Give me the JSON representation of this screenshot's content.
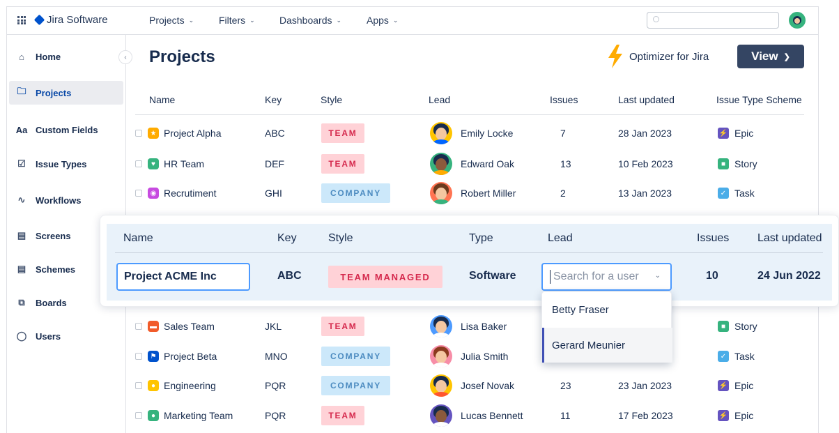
{
  "app": {
    "name": "Jira Software"
  },
  "topnav": {
    "items": [
      {
        "label": "Projects"
      },
      {
        "label": "Filters"
      },
      {
        "label": "Dashboards"
      },
      {
        "label": "Apps"
      }
    ],
    "search": {
      "placeholder": ""
    }
  },
  "sidebar": {
    "items": [
      {
        "label": "Home",
        "icon": "home-icon"
      },
      {
        "label": "Projects",
        "icon": "folder-icon",
        "active": true
      },
      {
        "label": "Custom Fields",
        "icon": "text-icon"
      },
      {
        "label": "Issue Types",
        "icon": "check-circle-icon"
      },
      {
        "label": "Workflows",
        "icon": "workflow-icon"
      },
      {
        "label": "Screens",
        "icon": "screen-icon"
      },
      {
        "label": "Schemes",
        "icon": "scheme-icon"
      },
      {
        "label": "Boards",
        "icon": "board-icon"
      },
      {
        "label": "Users",
        "icon": "user-icon"
      }
    ]
  },
  "main": {
    "title": "Projects",
    "optimizer_label": "Optimizer for Jira",
    "view_button": "View",
    "columns": [
      "Name",
      "Key",
      "Style",
      "Lead",
      "Issues",
      "Last updated",
      "Issue Type Scheme"
    ],
    "rows": [
      {
        "name": "Project Alpha",
        "key": "ABC",
        "style": "TEAM",
        "lead": "Emily Locke",
        "issues": "7",
        "updated": "28 Jan 2023",
        "scheme": "Epic"
      },
      {
        "name": "HR Team",
        "key": "DEF",
        "style": "TEAM",
        "lead": "Edward Oak",
        "issues": "13",
        "updated": "10 Feb 2023",
        "scheme": "Story"
      },
      {
        "name": "Recrutiment",
        "key": "GHI",
        "style": "COMPANY",
        "lead": "Robert Miller",
        "issues": "2",
        "updated": "13 Jan 2023",
        "scheme": "Task"
      },
      {
        "name": "Sales Team",
        "key": "JKL",
        "style": "TEAM",
        "lead": "Lisa Baker",
        "issues": "",
        "updated": "",
        "scheme": "Story"
      },
      {
        "name": "Project Beta",
        "key": "MNO",
        "style": "COMPANY",
        "lead": "Julia Smith",
        "issues": "",
        "updated": "",
        "scheme": "Task"
      },
      {
        "name": "Engineering",
        "key": "PQR",
        "style": "COMPANY",
        "lead": "Josef Novak",
        "issues": "23",
        "updated": "23 Jan 2023",
        "scheme": "Epic"
      },
      {
        "name": "Marketing Team",
        "key": "PQR",
        "style": "TEAM",
        "lead": "Lucas Bennett",
        "issues": "11",
        "updated": "17 Feb 2023",
        "scheme": "Epic"
      }
    ]
  },
  "overlay": {
    "columns": [
      "Name",
      "Key",
      "Style",
      "Type",
      "Lead",
      "Issues",
      "Last updated"
    ],
    "name": "Project ACME Inc",
    "key": "ABC",
    "style": "TEAM MANAGED",
    "type": "Software",
    "lead_placeholder": "Search for a user",
    "issues": "10",
    "updated": "24 Jun 2022",
    "dropdown": [
      "Betty Fraser",
      "Gerard Meunier"
    ]
  },
  "colors": {
    "accent": "#0052CC",
    "team_bg": "#FFD2D7",
    "team_fg": "#D5294D",
    "company_bg": "#CCE8FA",
    "company_fg": "#4C8BC0",
    "epic": "#6554C0",
    "story": "#36B37E",
    "task": "#4BADE8"
  }
}
